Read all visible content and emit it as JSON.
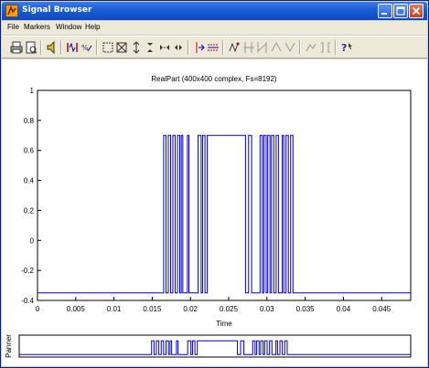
{
  "window": {
    "title": "Signal Browser",
    "accent": "#0b47c2"
  },
  "menu": {
    "items": [
      "File",
      "Markers",
      "Window",
      "Help"
    ]
  },
  "toolbar": {
    "icons": [
      "print-icon",
      "print-preview-icon",
      "play-sound-icon",
      "select-all-icon",
      "select-trace-icon",
      "zoom-box-icon",
      "zoom-full-icon",
      "zoom-vertical-in-icon",
      "zoom-vertical-out-icon",
      "zoom-horizontal-in-icon",
      "zoom-horizontal-out-icon",
      "marker-vertical-icon",
      "marker-horizontal-icon",
      "marker-add-icon",
      "marker-track-icon",
      "marker-slope-icon",
      "marker-peak-icon",
      "marker-valley-icon",
      "array-display-icon",
      "panner-icon",
      "help-icon"
    ]
  },
  "plot": {
    "title": "RealPart (400x400 complex, Fs=8192)",
    "xlabel": "Time",
    "panner_label": "Panner"
  },
  "chart_data": {
    "type": "line",
    "title": "RealPart (400x400 complex, Fs=8192)",
    "xlabel": "Time",
    "ylabel": "",
    "xlim": [
      0,
      0.0488
    ],
    "ylim": [
      -0.4,
      1
    ],
    "xticks": [
      0,
      0.005,
      0.01,
      0.015,
      0.02,
      0.025,
      0.03,
      0.035,
      0.04,
      0.045
    ],
    "yticks": [
      -0.4,
      -0.2,
      0,
      0.2,
      0.4,
      0.6,
      0.8,
      1
    ],
    "grid": false,
    "series_color": "#0000cc",
    "baseline": -0.35,
    "high": 0.7,
    "pulses": [
      [
        0.0165,
        0.0168
      ],
      [
        0.0171,
        0.0174
      ],
      [
        0.0177,
        0.018
      ],
      [
        0.0183,
        0.0186
      ],
      [
        0.0188,
        0.019
      ],
      [
        0.0196,
        0.0198
      ],
      [
        0.021,
        0.0214
      ],
      [
        0.0216,
        0.0219
      ],
      [
        0.0222,
        0.0272
      ],
      [
        0.0276,
        0.028
      ],
      [
        0.0291,
        0.0294
      ],
      [
        0.0296,
        0.0299
      ],
      [
        0.0301,
        0.0304
      ],
      [
        0.0306,
        0.0309
      ],
      [
        0.0312,
        0.0315
      ],
      [
        0.032,
        0.0322
      ],
      [
        0.0325,
        0.0328
      ],
      [
        0.0331,
        0.0334
      ]
    ]
  }
}
